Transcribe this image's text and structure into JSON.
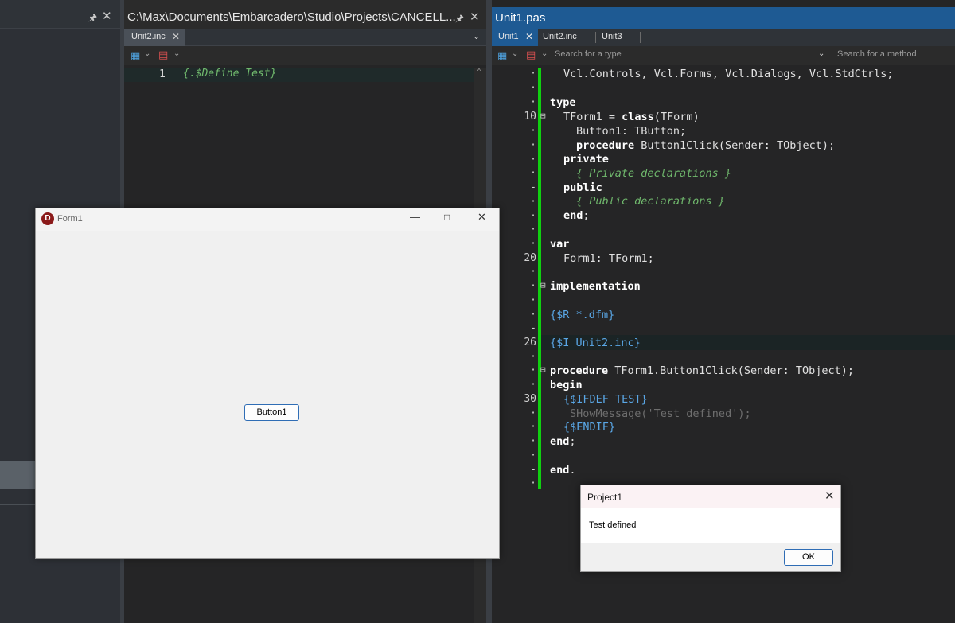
{
  "left_panel": {
    "pin_icon": "pin-icon",
    "close_icon": "close-icon"
  },
  "include_editor": {
    "title": "C:\\Max\\Documents\\Embarcadero\\Studio\\Projects\\CANCELL...",
    "tab_label": "Unit2.inc",
    "line_number": "1",
    "code": "{.$Define Test}"
  },
  "main_editor": {
    "title": "Unit1.pas",
    "tabs": [
      {
        "label": "Unit1"
      },
      {
        "label": "Unit2.inc"
      },
      {
        "label": "Unit3"
      }
    ],
    "type_search_placeholder": "Search for a type",
    "method_search_placeholder": "Search for a method",
    "gutter_numbers": [
      "10",
      "20",
      "26",
      "30"
    ]
  },
  "form1": {
    "title": "Form1",
    "button_label": "Button1"
  },
  "dialog": {
    "title": "Project1",
    "message": "Test defined",
    "ok_label": "OK"
  },
  "colors": {
    "accent": "#1e5a93",
    "change_bar": "#10d010",
    "comment": "#70b96d",
    "directive": "#5aa7e6"
  }
}
